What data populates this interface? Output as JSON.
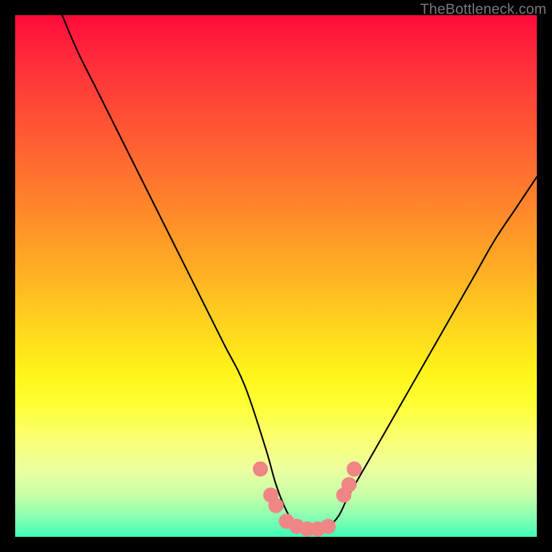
{
  "watermark": "TheBottleneck.com",
  "chart_data": {
    "type": "line",
    "title": "",
    "xlabel": "",
    "ylabel": "",
    "xlim": [
      0,
      100
    ],
    "ylim": [
      0,
      100
    ],
    "grid": false,
    "series": [
      {
        "name": "bottleneck-curve",
        "color": "#000000",
        "x": [
          9,
          12,
          16,
          20,
          24,
          28,
          32,
          36,
          40,
          44,
          48,
          50,
          52,
          54,
          56,
          58,
          60,
          62,
          64,
          68,
          72,
          76,
          80,
          84,
          88,
          92,
          96,
          100
        ],
        "y": [
          100,
          93,
          85,
          77,
          69,
          61,
          53,
          45,
          37,
          29,
          17,
          10,
          5,
          2,
          1,
          1,
          2,
          4,
          8,
          15,
          22,
          29,
          36,
          43,
          50,
          57,
          63,
          69
        ]
      }
    ],
    "markers": [
      {
        "name": "left-cluster",
        "color": "#ef8585",
        "points": [
          {
            "x": 47,
            "y": 13
          },
          {
            "x": 49,
            "y": 8
          },
          {
            "x": 50,
            "y": 6
          },
          {
            "x": 52,
            "y": 3
          },
          {
            "x": 54,
            "y": 2
          },
          {
            "x": 56,
            "y": 1.5
          },
          {
            "x": 58,
            "y": 1.5
          },
          {
            "x": 60,
            "y": 2
          }
        ]
      },
      {
        "name": "right-cluster",
        "color": "#ef8585",
        "points": [
          {
            "x": 63,
            "y": 8
          },
          {
            "x": 64,
            "y": 10
          },
          {
            "x": 65,
            "y": 13
          }
        ]
      }
    ],
    "legend": false
  }
}
